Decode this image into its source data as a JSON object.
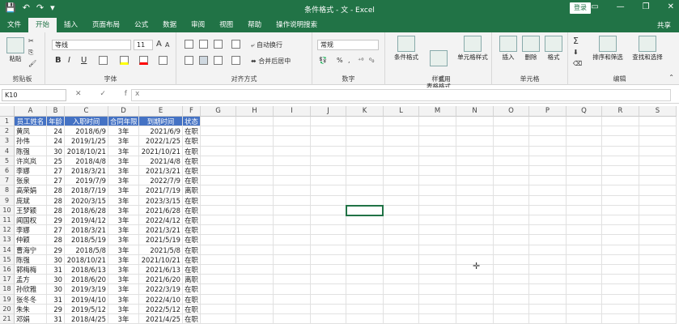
{
  "titlebar": {
    "title": "条件格式 - 文 - Excel",
    "login": "登录",
    "qat": [
      "💾",
      "↶",
      "↷",
      "▾"
    ],
    "win": [
      "▭",
      "—",
      "❐",
      "✕"
    ]
  },
  "tabs": [
    "文件",
    "开始",
    "插入",
    "页面布局",
    "公式",
    "数据",
    "审阅",
    "视图",
    "帮助",
    "操作说明搜索"
  ],
  "active_tab": "开始",
  "share": "共享",
  "ribbon": {
    "clipboard": {
      "label": "剪贴板",
      "paste": "粘贴"
    },
    "font": {
      "label": "字体",
      "name": "等线",
      "size": "11",
      "grow": "A",
      "shrink": "A",
      "bold": "B",
      "italic": "I",
      "underline": "U"
    },
    "align": {
      "label": "对齐方式",
      "wrap": "自动换行",
      "merge": "合并后居中"
    },
    "number": {
      "label": "数字",
      "format": "常规"
    },
    "styles": {
      "label": "样式",
      "cond": "条件格式",
      "table": "套用\n表格格式",
      "cell": "单元格样式"
    },
    "cells": {
      "label": "单元格",
      "insert": "插入",
      "delete": "删除",
      "format": "格式"
    },
    "edit": {
      "label": "编辑",
      "sort": "排序和筛选",
      "find": "查找和选择"
    }
  },
  "formula": {
    "namebox": "K10",
    "fx": "✕ ✓ fx",
    "value": ""
  },
  "columns": [
    "A",
    "B",
    "C",
    "D",
    "E",
    "F",
    "G",
    "H",
    "I",
    "J",
    "K",
    "L",
    "M",
    "N",
    "O",
    "P",
    "Q",
    "R",
    "S"
  ],
  "header_row": [
    "员工姓名",
    "年龄",
    "入职时间",
    "合同年限",
    "到期时间",
    "状态"
  ],
  "rows": [
    [
      "黄凤",
      "24",
      "2018/6/9",
      "3年",
      "2021/6/9",
      "在职"
    ],
    [
      "孙伟",
      "24",
      "2019/1/25",
      "3年",
      "2022/1/25",
      "在职"
    ],
    [
      "陈强",
      "30",
      "2018/10/21",
      "3年",
      "2021/10/21",
      "在职"
    ],
    [
      "许岚岚",
      "25",
      "2018/4/8",
      "3年",
      "2021/4/8",
      "在职"
    ],
    [
      "李娜",
      "27",
      "2018/3/21",
      "3年",
      "2021/3/21",
      "在职"
    ],
    [
      "张泉",
      "27",
      "2019/7/9",
      "3年",
      "2022/7/9",
      "在职"
    ],
    [
      "高荣娟",
      "28",
      "2018/7/19",
      "3年",
      "2021/7/19",
      "离职"
    ],
    [
      "庞斌",
      "28",
      "2020/3/15",
      "3年",
      "2023/3/15",
      "在职"
    ],
    [
      "王梦颖",
      "28",
      "2018/6/28",
      "3年",
      "2021/6/28",
      "在职"
    ],
    [
      "闻国权",
      "29",
      "2019/4/12",
      "3年",
      "2022/4/12",
      "在职"
    ],
    [
      "李娜",
      "27",
      "2018/3/21",
      "3年",
      "2021/3/21",
      "在职"
    ],
    [
      "仲颖",
      "28",
      "2018/5/19",
      "3年",
      "2021/5/19",
      "在职"
    ],
    [
      "曹海宁",
      "29",
      "2018/5/8",
      "3年",
      "2021/5/8",
      "在职"
    ],
    [
      "陈强",
      "30",
      "2018/10/21",
      "3年",
      "2021/10/21",
      "在职"
    ],
    [
      "郭梅梅",
      "31",
      "2018/6/13",
      "3年",
      "2021/6/13",
      "在职"
    ],
    [
      "孟方",
      "30",
      "2018/6/20",
      "3年",
      "2021/6/20",
      "离职"
    ],
    [
      "孙欣雅",
      "30",
      "2019/3/19",
      "3年",
      "2022/3/19",
      "在职"
    ],
    [
      "张冬冬",
      "31",
      "2019/4/10",
      "3年",
      "2022/4/10",
      "在职"
    ],
    [
      "朱朱",
      "29",
      "2019/5/12",
      "3年",
      "2022/5/12",
      "在职"
    ],
    [
      "邓娟",
      "31",
      "2018/4/25",
      "3年",
      "2021/4/25",
      "在职"
    ]
  ],
  "row_numbers": [
    "1",
    "2",
    "3",
    "4",
    "5",
    "6",
    "7",
    "8",
    "9",
    "10",
    "11",
    "12",
    "13",
    "14",
    "15",
    "16",
    "17",
    "18",
    "19",
    "20",
    "21",
    "22"
  ],
  "selected_cell": "K10",
  "colors": {
    "accent": "#217346",
    "header_fill": "#4472c4"
  }
}
